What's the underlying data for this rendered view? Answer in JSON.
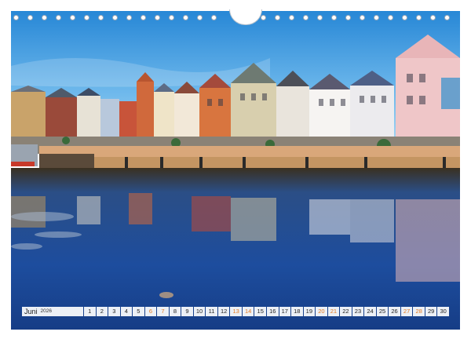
{
  "calendar": {
    "month": "Juni",
    "year": "2026",
    "days": [
      "1",
      "2",
      "3",
      "4",
      "5",
      "6",
      "7",
      "8",
      "9",
      "10",
      "11",
      "12",
      "13",
      "14",
      "15",
      "16",
      "17",
      "18",
      "19",
      "20",
      "21",
      "22",
      "23",
      "24",
      "25",
      "26",
      "27",
      "28",
      "29",
      "30"
    ],
    "weekend_days": [
      "6",
      "7",
      "13",
      "14",
      "20",
      "21",
      "27",
      "28"
    ]
  },
  "colors": {
    "sky_top": "#2d8fd8",
    "sky_bottom": "#8ec9ee",
    "water": "#1f4f99",
    "weekend_text": "#e4791f"
  }
}
